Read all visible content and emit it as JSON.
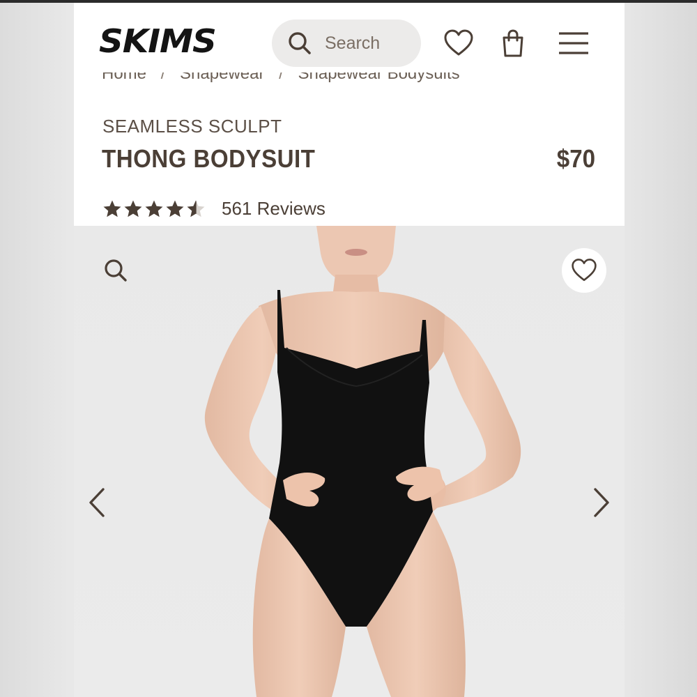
{
  "brand": {
    "logo_text": "SKIMS",
    "accent": "#4b3f36"
  },
  "header": {
    "search_label": "Search",
    "icons": [
      "search-icon",
      "heart-icon",
      "shopping-bag-icon",
      "hamburger-menu-icon"
    ]
  },
  "breadcrumb": {
    "items": [
      "Home",
      "Shapewear",
      "Shapewear Bodysuits"
    ],
    "separator": "/"
  },
  "product": {
    "collection": "SEAMLESS SCULPT",
    "name": "THONG BODYSUIT",
    "price": "$70",
    "rating": 4.5,
    "reviews_label": "561 Reviews"
  },
  "gallery": {
    "icons": [
      "zoom-icon",
      "wishlist-heart-icon",
      "chevron-left-icon",
      "chevron-right-icon"
    ],
    "background": "#ebebeb"
  }
}
